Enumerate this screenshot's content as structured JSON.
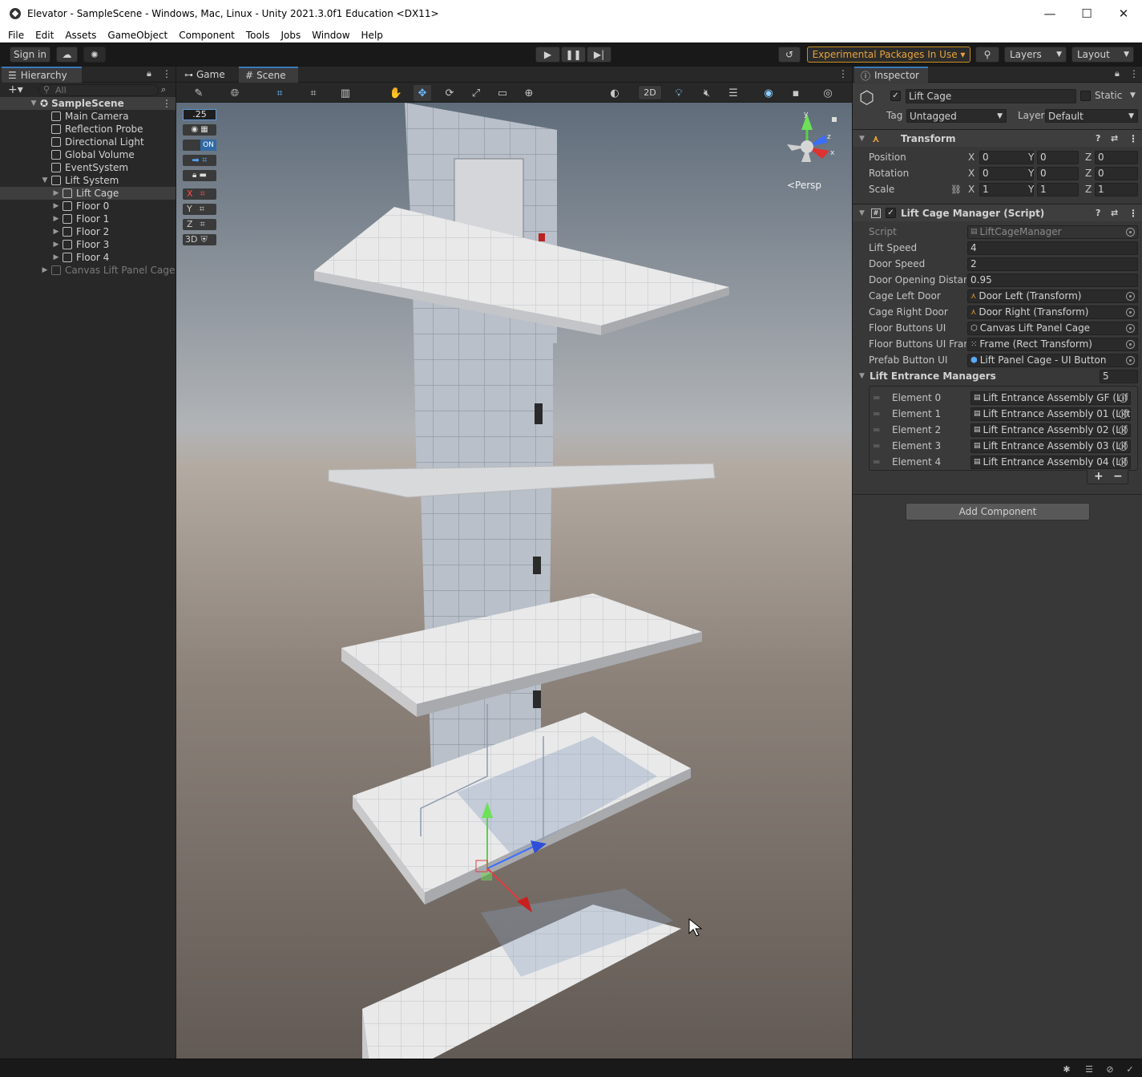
{
  "window": {
    "title": "Elevator - SampleScene - Windows, Mac, Linux - Unity 2021.3.0f1 Education <DX11>",
    "minimize": "—",
    "maximize": "☐",
    "close": "✕"
  },
  "menu": [
    "File",
    "Edit",
    "Assets",
    "GameObject",
    "Component",
    "Tools",
    "Jobs",
    "Window",
    "Help"
  ],
  "toolbar": {
    "sign_in": "Sign in",
    "experimental": "Experimental Packages In Use ▾",
    "layers": "Layers",
    "layout": "Layout"
  },
  "hierarchy": {
    "title": "Hierarchy",
    "search_placeholder": "All",
    "scene": "SampleScene",
    "items": [
      {
        "label": "Main Camera"
      },
      {
        "label": "Reflection Probe"
      },
      {
        "label": "Directional Light"
      },
      {
        "label": "Global Volume"
      },
      {
        "label": "EventSystem"
      },
      {
        "label": "Lift System"
      },
      {
        "label": "Lift Cage"
      },
      {
        "label": "Floor 0"
      },
      {
        "label": "Floor 1"
      },
      {
        "label": "Floor 2"
      },
      {
        "label": "Floor 3"
      },
      {
        "label": "Floor 4"
      },
      {
        "label": "Canvas Lift Panel Cage"
      }
    ]
  },
  "scene_view": {
    "tabs": [
      "Game",
      "Scene"
    ],
    "active_tab": "Scene",
    "grid_size": ".25",
    "on_toggle": "ON",
    "axis_x": "X",
    "axis_y": "Y",
    "axis_z": "Z",
    "mode_3d": "3D",
    "btn_2d": "2D",
    "gizmo_y": "y",
    "gizmo_z": "z",
    "gizmo_x": "x",
    "persp": "<Persp"
  },
  "inspector": {
    "title": "Inspector",
    "object_name": "Lift Cage",
    "static_label": "Static",
    "tag_label": "Tag",
    "tag_value": "Untagged",
    "layer_label": "Layer",
    "layer_value": "Default",
    "transform": {
      "title": "Transform",
      "position_label": "Position",
      "rotation_label": "Rotation",
      "scale_label": "Scale",
      "position": {
        "x": "0",
        "y": "0",
        "z": "0"
      },
      "rotation": {
        "x": "0",
        "y": "0",
        "z": "0"
      },
      "scale": {
        "x": "1",
        "y": "1",
        "z": "1"
      }
    },
    "script": {
      "title": "Lift Cage Manager (Script)",
      "fields": [
        {
          "label": "Script",
          "value": "LiftCageManager"
        },
        {
          "label": "Lift Speed",
          "value": "4"
        },
        {
          "label": "Door Speed",
          "value": "2"
        },
        {
          "label": "Door Opening Distanc",
          "value": "0.95"
        },
        {
          "label": "Cage Left Door",
          "value": "Door Left (Transform)"
        },
        {
          "label": "Cage Right Door",
          "value": "Door Right (Transform)"
        },
        {
          "label": "Floor Buttons UI",
          "value": "Canvas Lift Panel Cage"
        },
        {
          "label": "Floor Buttons UI Fram",
          "value": "Frame (Rect Transform)"
        },
        {
          "label": "Prefab Button UI",
          "value": "Lift Panel Cage - UI Button"
        }
      ],
      "list_label": "Lift Entrance Managers",
      "list_count": "5",
      "elements": [
        {
          "label": "Element 0",
          "value": "Lift Entrance Assembly GF (Lif"
        },
        {
          "label": "Element 1",
          "value": "Lift Entrance Assembly 01 (Lift"
        },
        {
          "label": "Element 2",
          "value": "Lift Entrance Assembly 02 (Lif"
        },
        {
          "label": "Element 3",
          "value": "Lift Entrance Assembly 03 (Lif"
        },
        {
          "label": "Element 4",
          "value": "Lift Entrance Assembly 04 (Lif"
        }
      ],
      "add": "+",
      "remove": "−"
    },
    "add_component": "Add Component"
  }
}
